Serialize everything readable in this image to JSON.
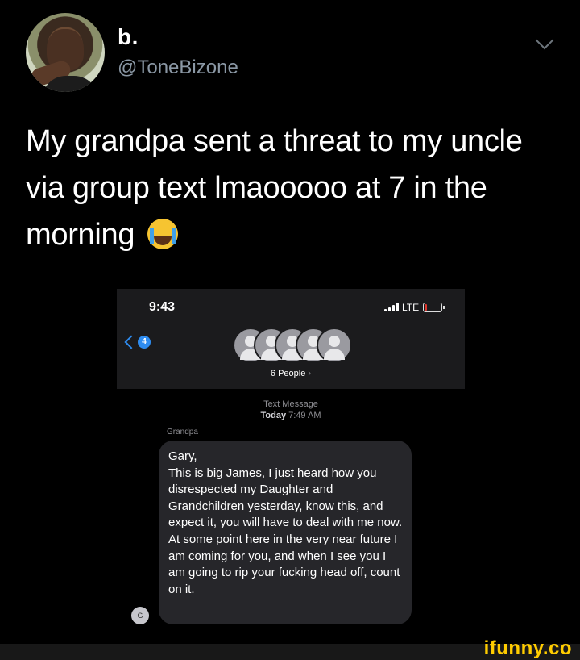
{
  "tweet": {
    "display_name": "b.",
    "handle": "@ToneBizone",
    "text_lines": [
      "My grandpa sent a threat to my uncle",
      "via group text lmaooooo at 7 in the",
      "morning"
    ],
    "emoji_name": "loudly-crying-face"
  },
  "screenshot": {
    "time": "9:43",
    "network": "LTE",
    "back_count": "4",
    "group_label": "6 People",
    "meta_type": "Text Message",
    "meta_day": "Today",
    "meta_time": "7:49 AM",
    "sender": "Grandpa",
    "avatar_initial": "G",
    "message": "Gary,\nThis is big James, I just heard how you disrespected my Daughter and Grandchildren yesterday, know this, and expect it, you will have to deal with me now. At some point here in the very near future I am coming for you, and when I see you I am going to rip your fucking head off, count on it."
  },
  "watermark": "ifunny.co",
  "colors": {
    "background": "#000000",
    "handle_gray": "#8b98a5",
    "imessage_blue": "#2e8cf0",
    "bubble_gray": "#26262a",
    "watermark_yellow": "#ffcc00"
  }
}
